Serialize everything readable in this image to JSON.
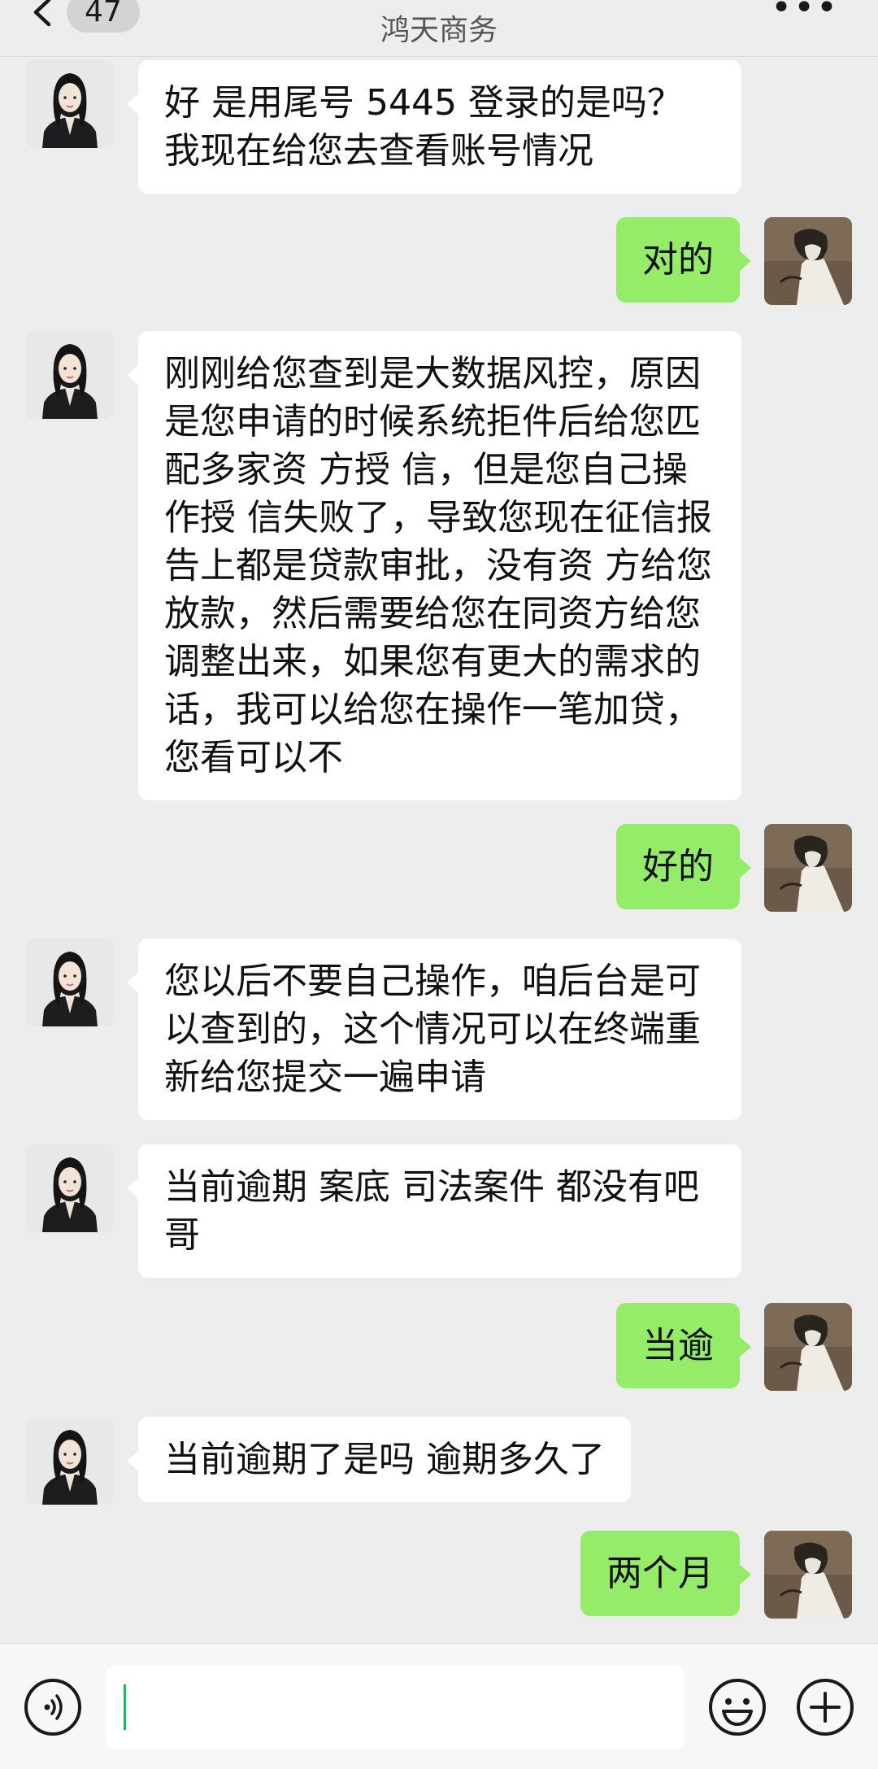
{
  "header": {
    "back_icon": "chevron-left-icon",
    "unread_count": "47",
    "title": "鸿天商务",
    "more_icon": "more-dots-icon",
    "more_label": "•••"
  },
  "messages": [
    {
      "side": "left",
      "avatar": "agent-avatar",
      "text": "好 是用尾号 5445 登录的是吗？我现在给您去查看账号情况"
    },
    {
      "side": "right",
      "avatar": "user-avatar",
      "text": "对的"
    },
    {
      "side": "left",
      "avatar": "agent-avatar",
      "text": "刚刚给您查到是大数据风控，原因是您申请的时候系统拒件后给您匹配多家资 方授 信，但是您自己操作授 信失败了，导致您现在征信报告上都是贷款审批，没有资 方给您放款，然后需要给您在同资方给您调整出来，如果您有更大的需求的话，我可以给您在操作一笔加贷，您看可以不"
    },
    {
      "side": "right",
      "avatar": "user-avatar",
      "text": "好的"
    },
    {
      "side": "left",
      "avatar": "agent-avatar",
      "text": "您以后不要自己操作，咱后台是可以查到的，这个情况可以在终端重新给您提交一遍申请"
    },
    {
      "side": "left",
      "avatar": "agent-avatar",
      "text": "当前逾期 案底 司法案件 都没有吧哥"
    },
    {
      "side": "right",
      "avatar": "user-avatar",
      "text": "当逾"
    },
    {
      "side": "left",
      "avatar": "agent-avatar",
      "text": "当前逾期了是吗 逾期多久了"
    },
    {
      "side": "right",
      "avatar": "user-avatar",
      "text": "两个月"
    }
  ],
  "input_bar": {
    "voice_icon": "voice-icon",
    "message_value": "",
    "emoji_icon": "emoji-icon",
    "add_icon": "plus-icon"
  },
  "colors": {
    "background": "#ededed",
    "incoming_bubble": "#ffffff",
    "outgoing_bubble": "#95ec69",
    "caret": "#07c160"
  }
}
